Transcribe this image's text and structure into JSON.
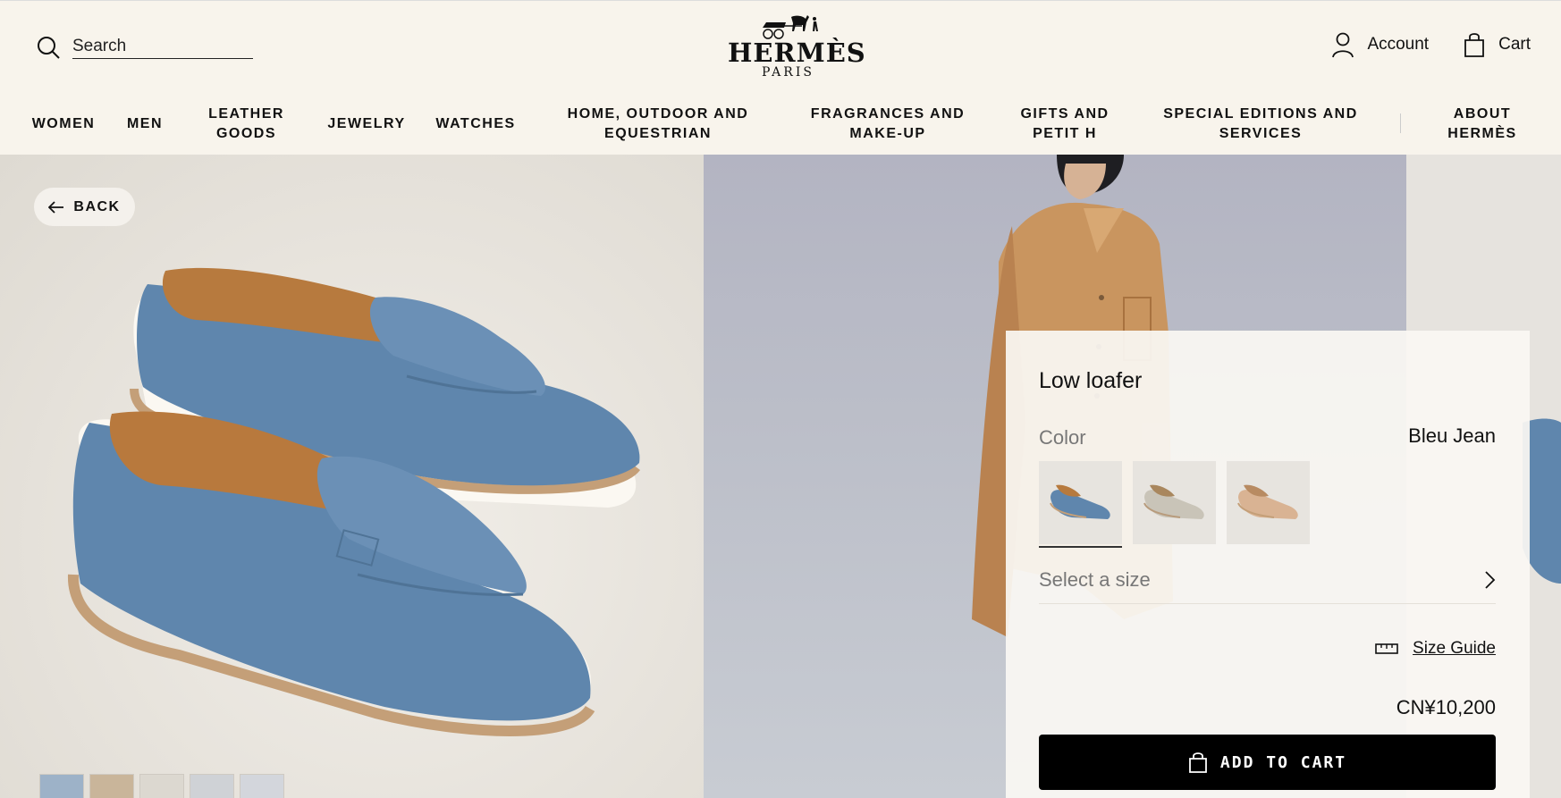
{
  "header": {
    "search_placeholder": "Search",
    "logo_name": "HERMÈS",
    "logo_sub": "PARIS",
    "account_label": "Account",
    "cart_label": "Cart"
  },
  "nav": [
    {
      "label": "WOMEN"
    },
    {
      "label": "MEN"
    },
    {
      "label": "LEATHER GOODS"
    },
    {
      "label": "JEWELRY"
    },
    {
      "label": "WATCHES"
    },
    {
      "label": "HOME, OUTDOOR AND EQUESTRIAN"
    },
    {
      "label": "FRAGRANCES AND MAKE-UP"
    },
    {
      "label": "GIFTS AND PETIT H"
    },
    {
      "label": "SPECIAL EDITIONS AND SERVICES"
    },
    {
      "label": "ABOUT HERMÈS"
    }
  ],
  "gallery": {
    "back_label": "BACK",
    "thumbnail_count": 5,
    "active_thumbnail": 1
  },
  "product": {
    "title": "Low loafer",
    "color_label": "Color",
    "color_value": "Bleu Jean",
    "swatches": [
      {
        "color": "#5f86ad",
        "selected": true
      },
      {
        "color": "#c9c4b8",
        "selected": false
      },
      {
        "color": "#d9b393",
        "selected": false
      }
    ],
    "size_placeholder": "Select a size",
    "size_guide_label": "Size Guide",
    "price": "CN¥10,200",
    "add_to_cart_label": "ADD TO CART"
  },
  "colors": {
    "background": "#f8f4ec",
    "button": "#000000",
    "loafer_blue": "#5f86ad",
    "coat": "#c9955f"
  }
}
